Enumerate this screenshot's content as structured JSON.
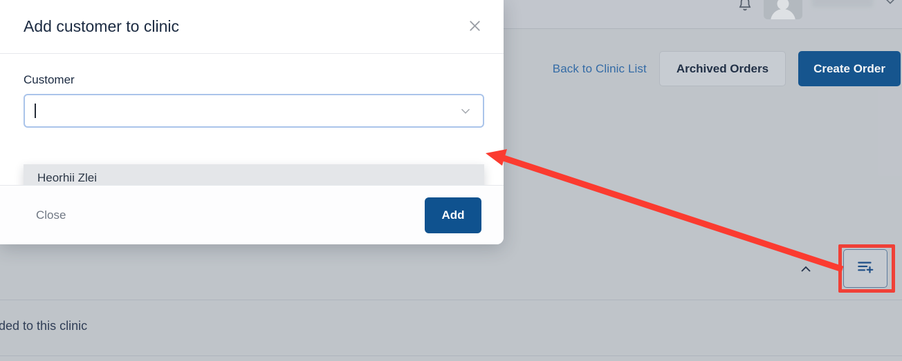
{
  "topbar": {
    "bell_icon": "bell-icon",
    "avatar": "avatar",
    "user_name_redacted": "",
    "chevron_icon": "chevron-down-icon"
  },
  "actions": {
    "back_link": "Back to Clinic List",
    "archived_orders": "Archived Orders",
    "create_order": "Create Order"
  },
  "bottom": {
    "truncated_text": "dded to this clinic",
    "collapse_icon": "chevron-up-icon",
    "add_to_list_icon": "list-add-icon"
  },
  "modal": {
    "title": "Add customer to clinic",
    "close_icon": "close-icon",
    "field_label": "Customer",
    "input_value": "",
    "input_placeholder": "",
    "dropdown_chevron": "chevron-down-icon",
    "options": [
      {
        "label": "Heorhii Zlei"
      }
    ],
    "footer": {
      "close_label": "Close",
      "add_label": "Add"
    }
  },
  "annotation": {
    "arrow_color": "#fb3b30",
    "highlight_color": "#fb3b30"
  },
  "colors": {
    "primary_blue": "#0f528f",
    "link_blue": "#2f6aa8",
    "page_bg": "#c6cacf",
    "text_dark": "#1b2a41"
  }
}
